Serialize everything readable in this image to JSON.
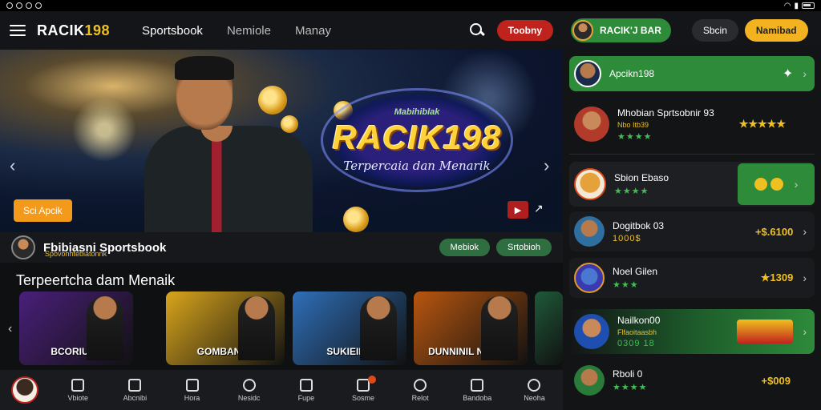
{
  "status": {
    "battery": ""
  },
  "header": {
    "brand_text": "RACIK",
    "brand_num": "198",
    "nav": [
      "Sportsbook",
      "Nemiole",
      "Manay"
    ],
    "red_button": "Toobny"
  },
  "right_header": {
    "user_label": "RACIK'J BAR",
    "btn_dark": "Sbcin",
    "btn_yellow": "Namibad"
  },
  "hero": {
    "logo_top": "Mabihiblak",
    "logo_main": "RACIK198",
    "logo_sub": "Terpercaia dan Menarik",
    "cta": "Sci Apcik"
  },
  "section": {
    "title": "Fbibiasni Sportsbook",
    "subtitle": "Spovonhtebiatonnk",
    "btn1": "Mebiok",
    "btn2": "Srtobioh"
  },
  "carousel": {
    "title": "Terpeertcha dam Menaik",
    "cards": [
      {
        "label": "BCORIUSE",
        "bg": "#4a1f7a"
      },
      {
        "label": "GOMBANES",
        "bg": "#d9a51c"
      },
      {
        "label": "SUKIEIKD",
        "bg": "#2f6fb8"
      },
      {
        "label": "DUNNINIL NIKSOF",
        "bg": "#b8560f"
      },
      {
        "label": "",
        "bg": "#1f5a3a"
      }
    ]
  },
  "bottom_nav": [
    "Vbiote",
    "Abcnibi",
    "Hora",
    "Nesidc",
    "Fupe",
    "Sosme",
    "Relot",
    "Bandoba",
    "Neoha"
  ],
  "right_panel": {
    "featured": {
      "name": "Apcikn198"
    },
    "items": [
      {
        "name": "Mhobian Sprtsobnir 93",
        "sub": "Nbo Itb39",
        "stars": "★★★★",
        "value": "★★★★★",
        "avatar": "#b23a2a"
      },
      {
        "name": "Sbion Ebaso",
        "sub": "",
        "stars": "★★★★",
        "value": "",
        "avatar": "#f2e9d8"
      },
      {
        "name": "Dogitbok 03",
        "sub": "",
        "stars": "1000$",
        "value": "+$.6100",
        "avatar": "#2f6fa0"
      },
      {
        "name": "Noel Gilen",
        "sub": "",
        "stars": "★★★",
        "value": "★1309",
        "avatar": "#3a3ab0"
      },
      {
        "name": "Nailkon00",
        "sub": "Flfaoitaasbh",
        "stars": "0309 18",
        "value": "",
        "avatar": "#1e4fb0"
      },
      {
        "name": "Rboli 0",
        "sub": "",
        "stars": "★★★★",
        "value": "+$009",
        "avatar": "#2a7a3a"
      }
    ]
  }
}
